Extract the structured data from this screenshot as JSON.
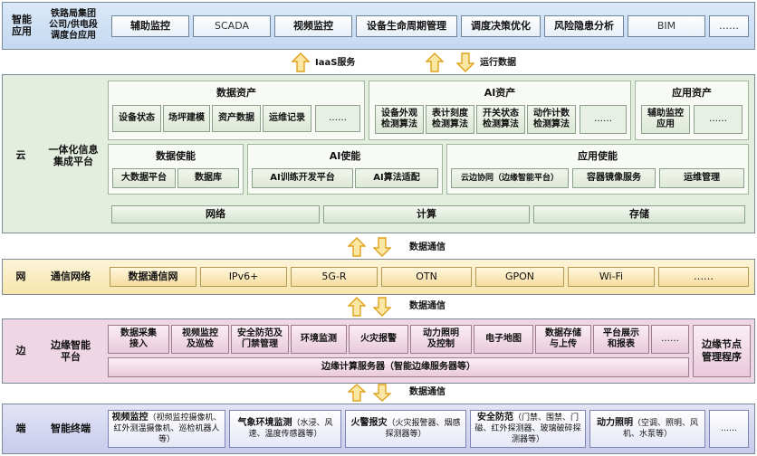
{
  "app_layer": {
    "name": "智能\n应用",
    "sub": "铁路局集团\n公司/供电段\n调度台应用",
    "items": [
      "辅助监控",
      "SCADA",
      "视频监控",
      "设备生命周期管理",
      "调度决策优化",
      "风险隐患分析",
      "BIM",
      "……"
    ]
  },
  "conn1": {
    "left": "IaaS服务",
    "right": "运行数据"
  },
  "cloud": {
    "name": "云",
    "sub": "一体化信息\n集成平台",
    "data_assets": {
      "title": "数据资产",
      "items": [
        "设备状态",
        "场坪建模",
        "资产数据",
        "运维记录",
        "……"
      ]
    },
    "ai_assets": {
      "title": "AI资产",
      "items": [
        "设备外观\n检测算法",
        "表计刻度\n检测算法",
        "开关状态\n检测算法",
        "动作计数\n检测算法",
        "……"
      ]
    },
    "app_assets": {
      "title": "应用资产",
      "items": [
        "辅助监控\n应用",
        "……"
      ]
    },
    "data_enable": {
      "title": "数据使能",
      "items": [
        "大数据平台",
        "数据库"
      ]
    },
    "ai_enable": {
      "title": "AI使能",
      "items": [
        "AI训练开发平台",
        "AI算法适配"
      ]
    },
    "app_enable": {
      "title": "应用使能",
      "items": [
        "云边协同（边缘智能平台）",
        "容器镜像服务",
        "运维管理"
      ]
    },
    "infra": [
      "网络",
      "计算",
      "存储"
    ]
  },
  "conn2": {
    "label": "数据通信"
  },
  "network": {
    "name": "网",
    "sub": "通信网络",
    "items": [
      "数据通信网",
      "IPv6+",
      "5G-R",
      "OTN",
      "GPON",
      "Wi-Fi",
      "……"
    ]
  },
  "conn3": {
    "label": "数据通信"
  },
  "edge": {
    "name": "边",
    "sub": "边缘智能\n平台",
    "items": [
      "数据采集\n接入",
      "视频监控\n及巡检",
      "安全防范及\n门禁管理",
      "环境监测",
      "火灾报警",
      "动力照明\n及控制",
      "电子地图",
      "数据存储\n与上传",
      "平台展示\n和报表",
      "……"
    ],
    "server": "边缘计算服务器（智能边缘服务器等）",
    "node": "边缘节点\n管理程序"
  },
  "conn4": {
    "label": "数据通信"
  },
  "terminal": {
    "name": "端",
    "sub": "智能终端",
    "items": [
      {
        "title": "视频监控",
        "detail": "（视频监控摄像机、红外测温摄像机、巡检机器人等）"
      },
      {
        "title": "气象环境监测",
        "detail": "（水浸、风速、温度传感器等）"
      },
      {
        "title": "火警报灾",
        "detail": "（火灾报警器、烟感探测器等）"
      },
      {
        "title": "安全防范",
        "detail": "（门禁、围禁、门磁、红外探测器、玻璃破碎探测器等）"
      },
      {
        "title": "动力照明",
        "detail": "（空调、照明、风机、水泵等）"
      },
      {
        "title": "……",
        "detail": ""
      }
    ]
  },
  "colors": {
    "app": "#c3d8f0",
    "cloud": "#e3eedf",
    "network": "#f7e5ac",
    "edge": "#efd6e4",
    "terminal": "#c8cbec",
    "arrow": "#f0b830"
  }
}
